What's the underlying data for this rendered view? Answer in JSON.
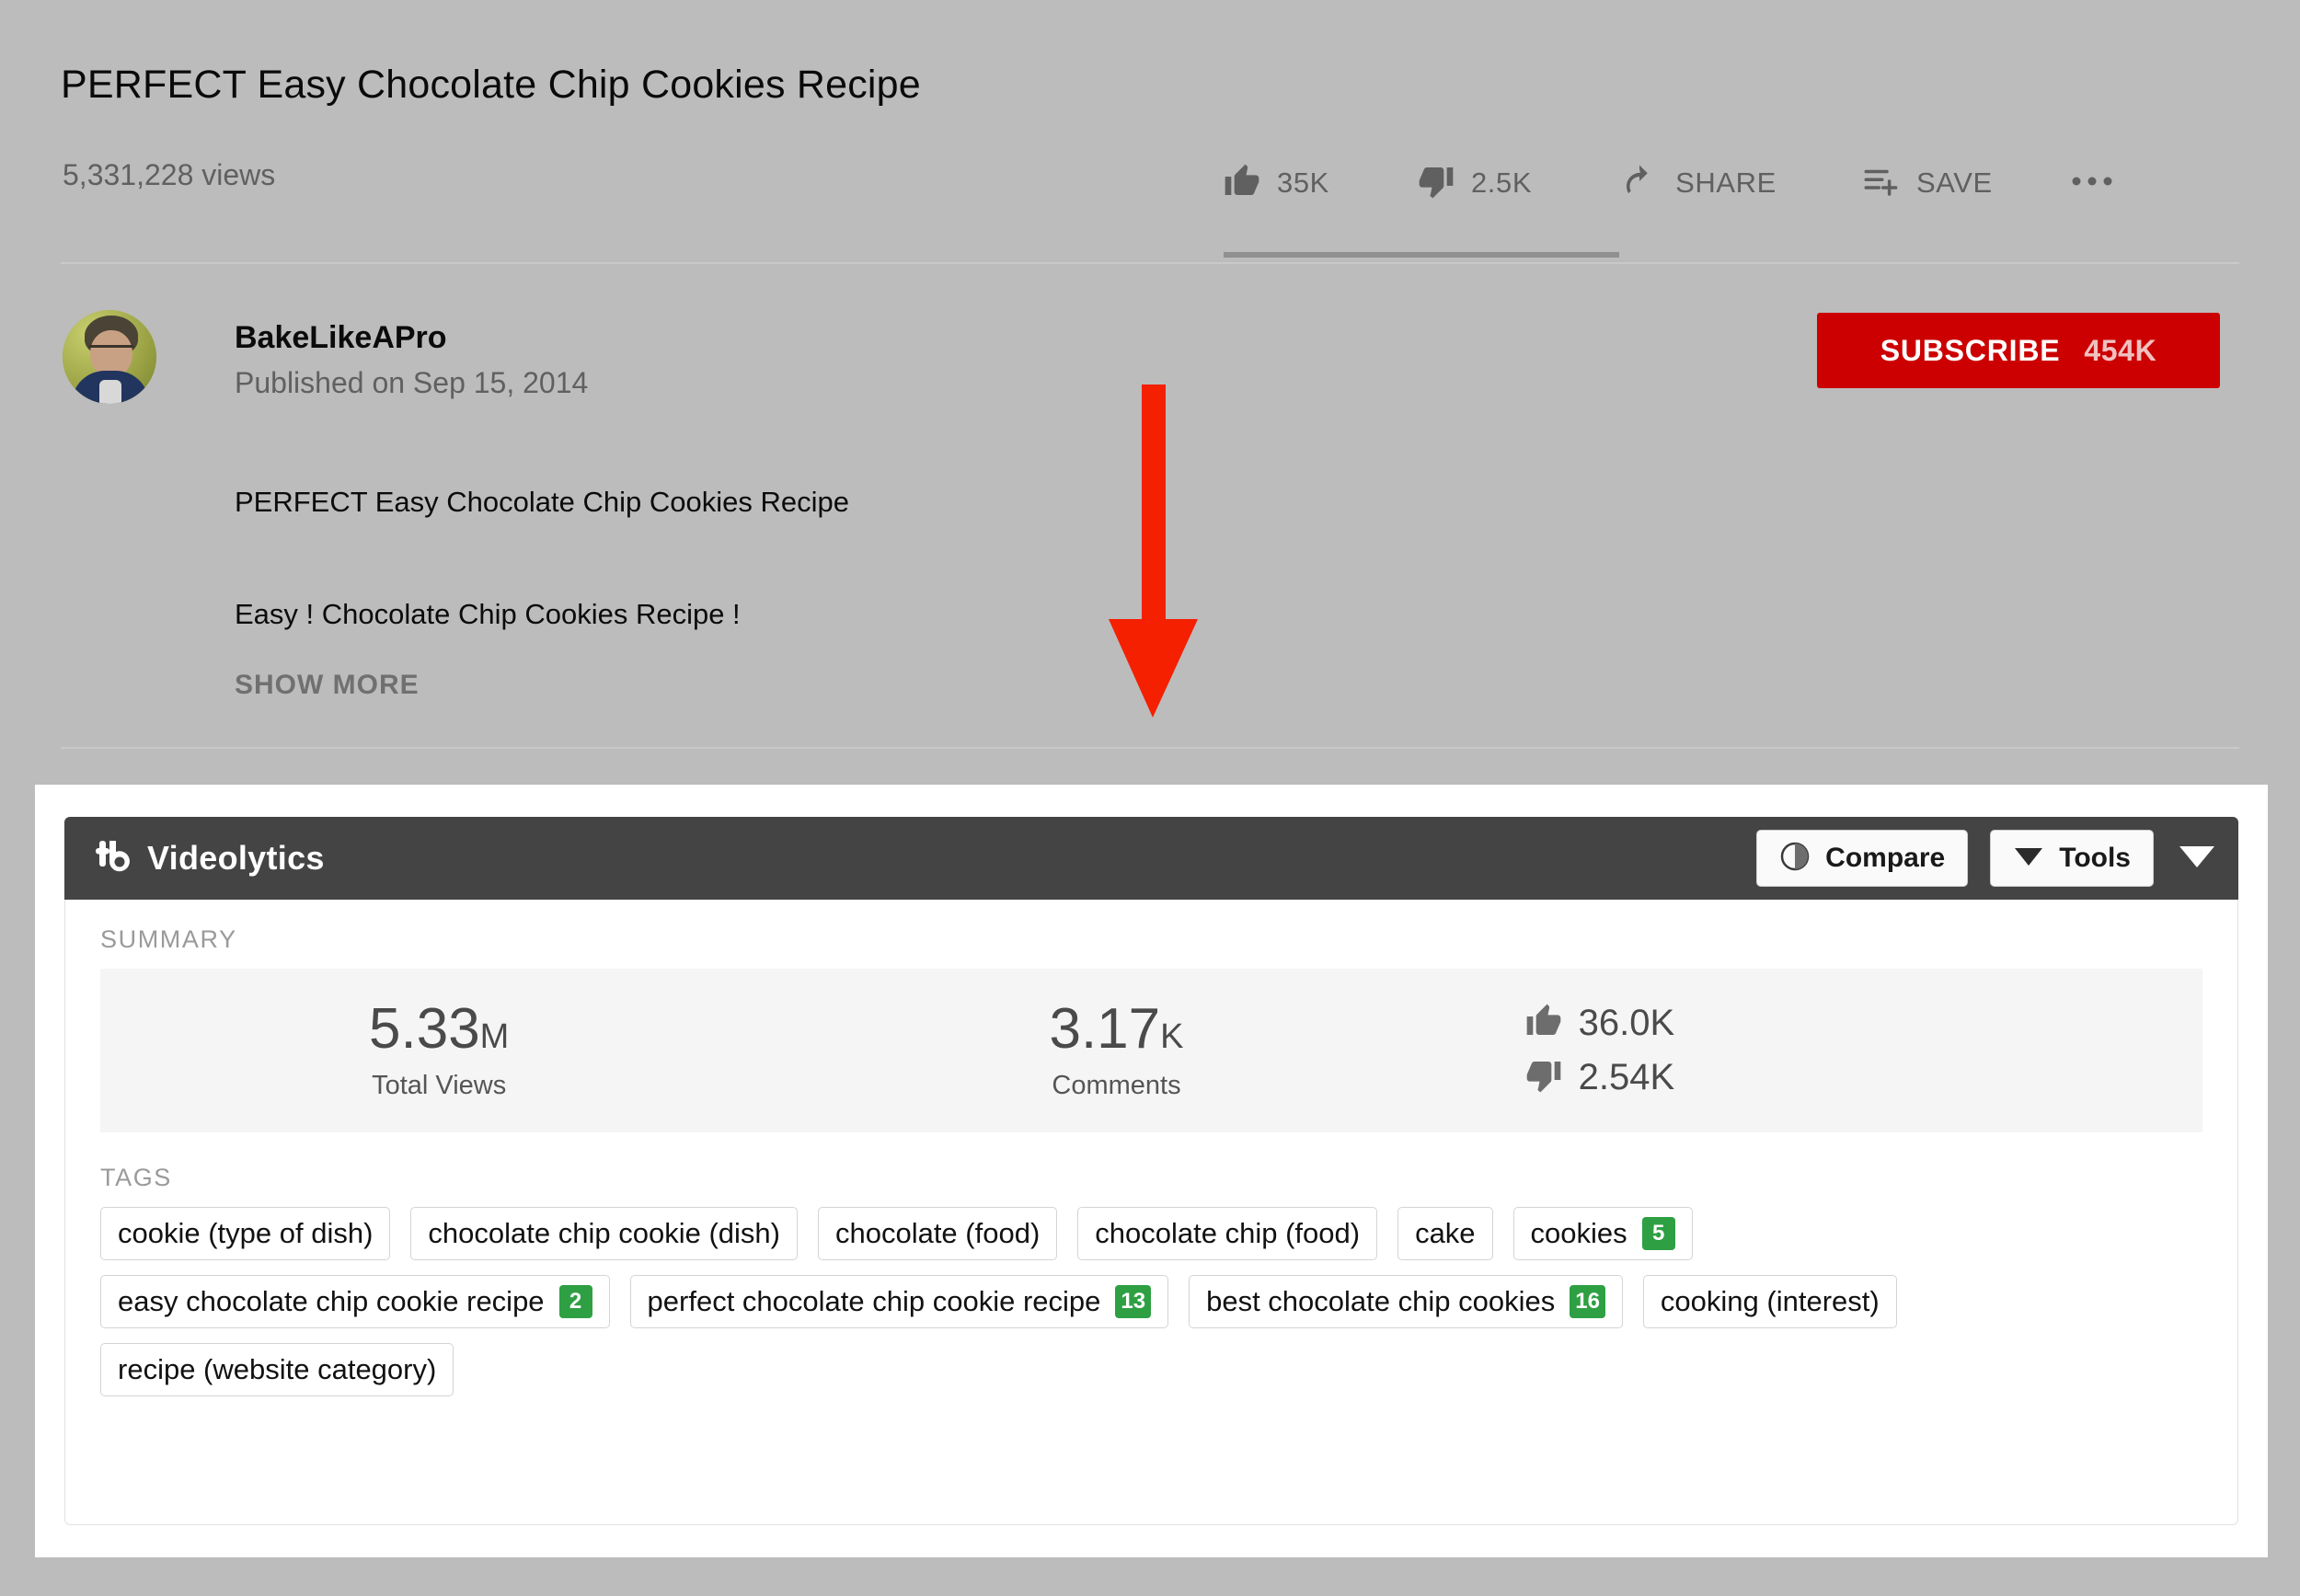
{
  "video": {
    "title": "PERFECT Easy Chocolate Chip Cookies Recipe",
    "view_count": "5,331,228 views",
    "actions": [
      {
        "name": "like",
        "icon": "thumbs-up-icon",
        "label": "35K"
      },
      {
        "name": "dislike",
        "icon": "thumbs-down-icon",
        "label": "2.5K"
      },
      {
        "name": "share",
        "icon": "share-arrow-icon",
        "label": "SHARE"
      },
      {
        "name": "save",
        "icon": "save-playlist-icon",
        "label": "SAVE"
      },
      {
        "name": "more",
        "icon": "more-horizontal-icon",
        "label": ""
      }
    ],
    "channel_name": "BakeLikeAPro",
    "published": "Published on Sep 15, 2014",
    "subscribe_label": "SUBSCRIBE",
    "subscriber_count": "454K",
    "description_lines": [
      "PERFECT Easy Chocolate Chip Cookies Recipe",
      "Easy ! Chocolate Chip Cookies Recipe !"
    ],
    "show_more_label": "SHOW MORE"
  },
  "annotation": {
    "type": "down-arrow",
    "color": "#f42000"
  },
  "tubebuddy": {
    "logo_text": "tb",
    "title": "Videolytics",
    "compare_label": "Compare",
    "tools_label": "Tools",
    "expand_icon": "chevron-down-icon",
    "summary_label": "SUMMARY",
    "stats": [
      {
        "value": "5.33",
        "unit": "M",
        "label": "Total Views"
      },
      {
        "value": "3.17",
        "unit": "K",
        "label": "Comments"
      }
    ],
    "ratings": [
      {
        "icon": "thumbs-up-icon",
        "value": "36.0K"
      },
      {
        "icon": "thumbs-down-icon",
        "value": "2.54K"
      }
    ],
    "tags_label": "TAGS",
    "tags": [
      {
        "text": "cookie (type of dish)",
        "badge": ""
      },
      {
        "text": "chocolate chip cookie (dish)",
        "badge": ""
      },
      {
        "text": "chocolate (food)",
        "badge": ""
      },
      {
        "text": "chocolate chip (food)",
        "badge": ""
      },
      {
        "text": "cake",
        "badge": ""
      },
      {
        "text": "cookies",
        "badge": "5"
      },
      {
        "text": "easy chocolate chip cookie recipe",
        "badge": "2"
      },
      {
        "text": "perfect chocolate chip cookie recipe",
        "badge": "13"
      },
      {
        "text": "best chocolate chip cookies",
        "badge": "16"
      },
      {
        "text": "cooking (interest)",
        "badge": ""
      },
      {
        "text": "recipe (website category)",
        "badge": ""
      }
    ],
    "badge_color": "#2ea043",
    "header_color": "#444444"
  }
}
